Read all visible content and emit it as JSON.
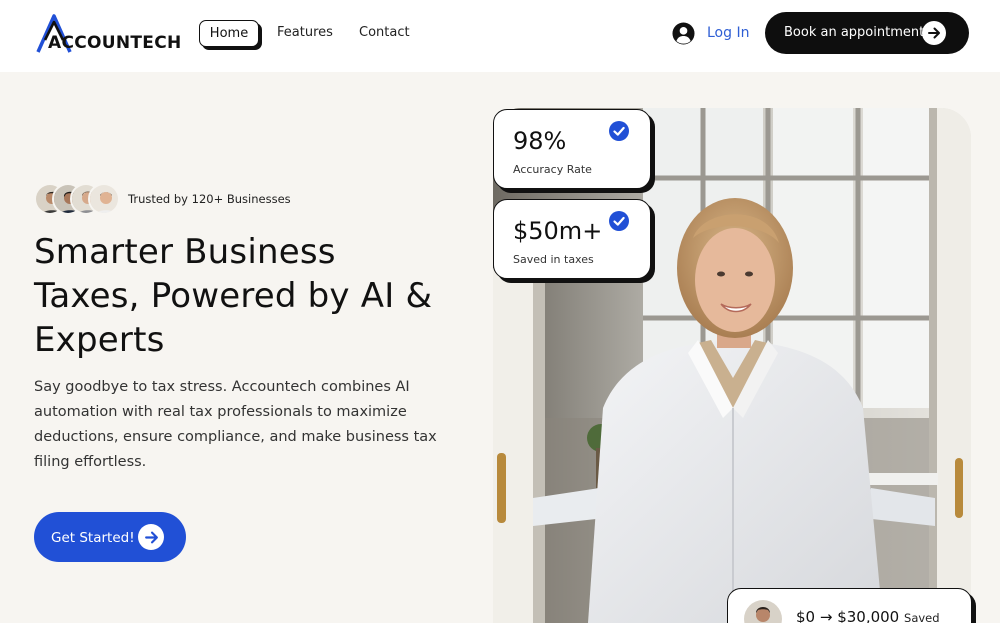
{
  "brand": {
    "name": "ACCOUNTECH",
    "accent": "#2150d6",
    "dark": "#0e0e0e"
  },
  "nav": {
    "home": "Home",
    "features": "Features",
    "contact": "Contact",
    "login": "Log In",
    "book": "Book an appointment"
  },
  "hero": {
    "trust": "Trusted by 120+ Businesses",
    "headline_1": "Smarter Business",
    "headline_2": "Taxes, Powered by AI &",
    "headline_3": "Experts",
    "subtext_1": "Say goodbye to tax stress. Accountech combines AI",
    "subtext_2": "automation with real tax professionals to maximize",
    "subtext_3": "deductions, ensure compliance, and make business tax",
    "subtext_4": "filing effortless.",
    "cta": "Get Started!"
  },
  "stats": [
    {
      "value": "98%",
      "label": "Accuracy Rate"
    },
    {
      "value": "$50m+",
      "label": "Saved in taxes"
    }
  ],
  "saved": {
    "amount": "$0 → $30,000",
    "suffix": "Saved"
  },
  "icons": {
    "logo": "accountech-logo-icon",
    "login": "user-circle-icon",
    "arrow": "arrow-right-icon",
    "check": "check-badge-icon"
  }
}
